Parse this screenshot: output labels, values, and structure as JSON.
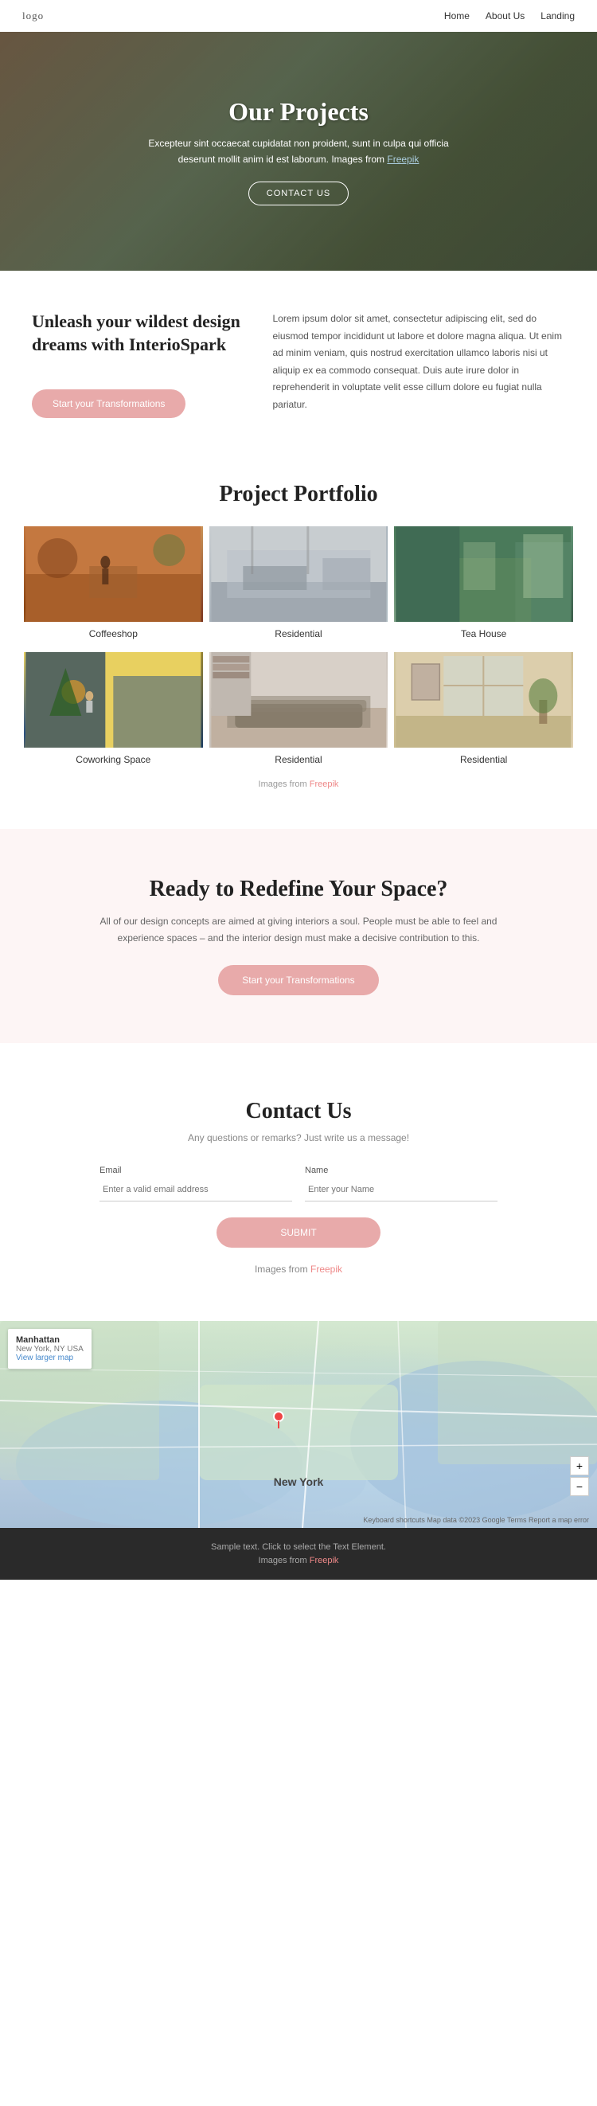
{
  "nav": {
    "logo": "logo",
    "links": [
      {
        "label": "Home",
        "href": "#"
      },
      {
        "label": "About Us",
        "href": "#"
      },
      {
        "label": "Landing",
        "href": "#"
      }
    ]
  },
  "hero": {
    "title": "Our Projects",
    "subtitle": "Excepteur sint occaecat cupidatat non proident, sunt in culpa qui officia deserunt mollit anim id est laborum. Images from",
    "freepik_link": "Freepik",
    "cta_button": "CONTACT US"
  },
  "about": {
    "heading": "Unleash your wildest design dreams with InterioSpark",
    "body": "Lorem ipsum dolor sit amet, consectetur adipiscing elit, sed do eiusmod tempor incididunt ut labore et dolore magna aliqua. Ut enim ad minim veniam, quis nostrud exercitation ullamco laboris nisi ut aliquip ex ea commodo consequat. Duis aute irure dolor in reprehenderit in voluptate velit esse cillum dolore eu fugiat nulla pariatur.",
    "cta_button": "Start your Transformations"
  },
  "portfolio": {
    "title": "Project Portfolio",
    "items": [
      {
        "label": "Coffeeshop"
      },
      {
        "label": "Residential"
      },
      {
        "label": "Tea House"
      },
      {
        "label": "Coworking Space"
      },
      {
        "label": "Residential"
      },
      {
        "label": "Residential"
      }
    ],
    "credit_prefix": "Images from",
    "credit_link": "Freepik"
  },
  "cta": {
    "title": "Ready to Redefine Your Space?",
    "body": "All of our design concepts are aimed at giving interiors a soul. People must be able to feel and experience spaces – and the interior design must make a decisive contribution to this.",
    "button": "Start your Transformations"
  },
  "contact": {
    "title": "Contact Us",
    "subtitle": "Any questions or remarks? Just write us a message!",
    "email_placeholder": "Enter a valid email address",
    "name_placeholder": "Enter your Name",
    "email_label": "Email",
    "name_label": "Name",
    "submit_button": "SUBMIT",
    "credit_prefix": "Images from",
    "credit_link": "Freepik"
  },
  "map": {
    "location": "Manhattan",
    "address": "New York, NY USA",
    "link_text": "View larger map",
    "city_label": "New York",
    "zoom_in": "+",
    "zoom_out": "−",
    "attribution": "Keyboard shortcuts  Map data ©2023 Google  Terms  Report a map error"
  },
  "footer": {
    "sample_text": "Sample text. Click to select the Text Element.",
    "credit_prefix": "Images from",
    "credit_link": "Freepik"
  }
}
